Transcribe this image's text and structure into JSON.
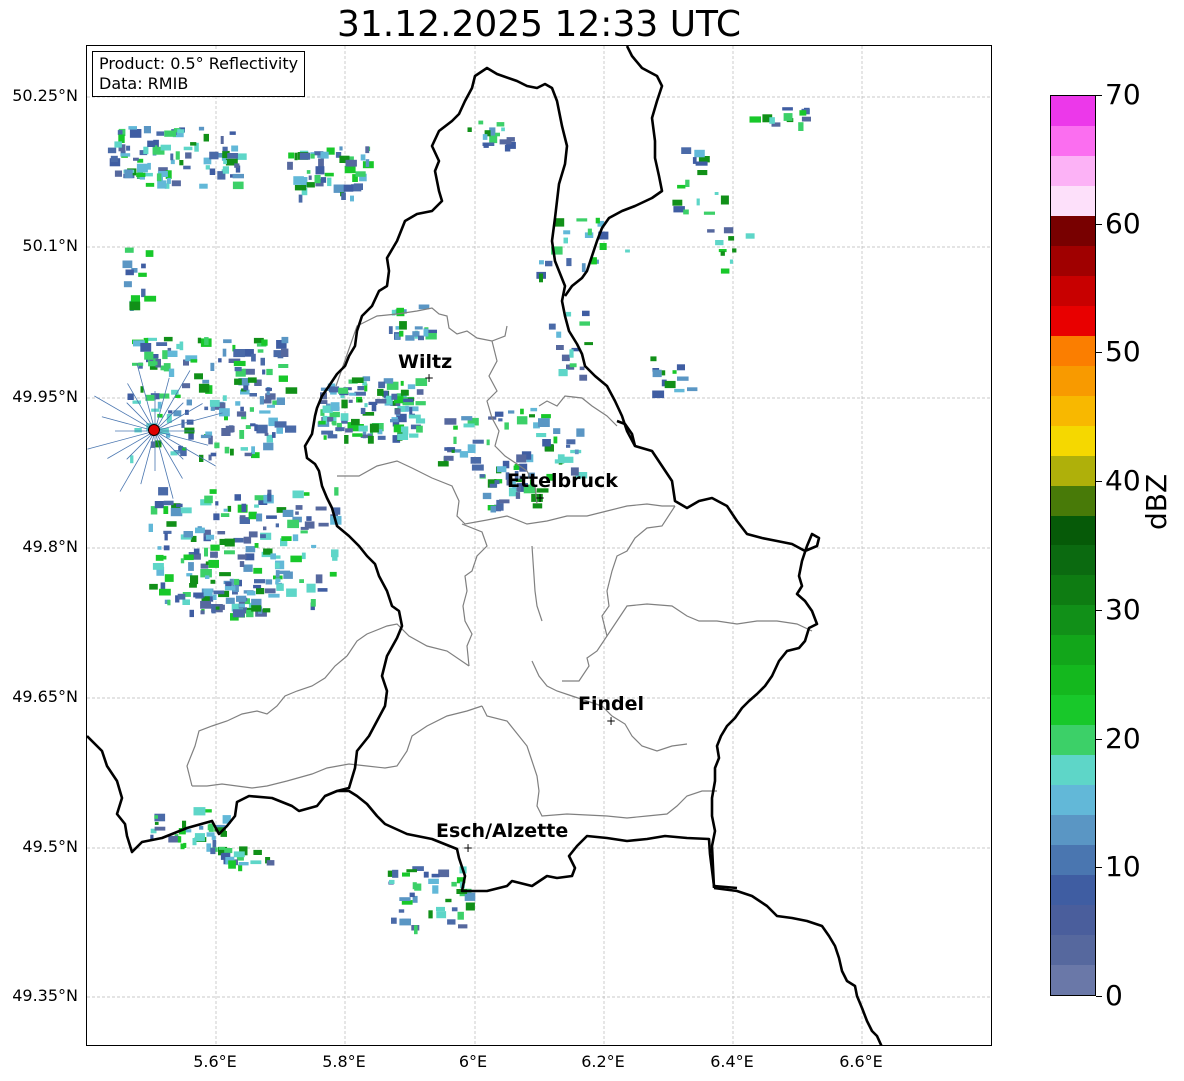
{
  "title": "31.12.2025 12:33 UTC",
  "info_box": {
    "product": "Product: 0.5° Reflectivity",
    "data": "Data: RMIB"
  },
  "latitude_labels": [
    "50.25°N",
    "50.1°N",
    "49.95°N",
    "49.8°N",
    "49.65°N",
    "49.5°N",
    "49.35°N"
  ],
  "longitude_labels": [
    "5.6°E",
    "5.8°E",
    "6°E",
    "6.2°E",
    "6.4°E",
    "6.6°E"
  ],
  "cities": [
    {
      "name": "Wiltz"
    },
    {
      "name": "Ettelbruck"
    },
    {
      "name": "Findel"
    },
    {
      "name": "Esch/Alzette"
    }
  ],
  "radar_site_color": "#e00000",
  "colorbar": {
    "label": "dBZ",
    "min": 0,
    "max": 70,
    "ticks": [
      "0",
      "10",
      "20",
      "30",
      "40",
      "50",
      "60",
      "70"
    ],
    "colors": [
      "#6a78a8",
      "#56689e",
      "#4a5e9c",
      "#3f5da2",
      "#4a76b0",
      "#5a96c4",
      "#62b8d8",
      "#5ed6c8",
      "#3cd068",
      "#18c82a",
      "#14b81e",
      "#12a61a",
      "#119018",
      "#0e7c12",
      "#0b6a10",
      "#065a08",
      "#487a08",
      "#afb00a",
      "#f5d800",
      "#f8b800",
      "#f89a00",
      "#fb7e00",
      "#e80000",
      "#c80000",
      "#a00000",
      "#780000",
      "#fde0fa",
      "#fcb2f6",
      "#fb6ef0",
      "#ec38ea"
    ]
  }
}
